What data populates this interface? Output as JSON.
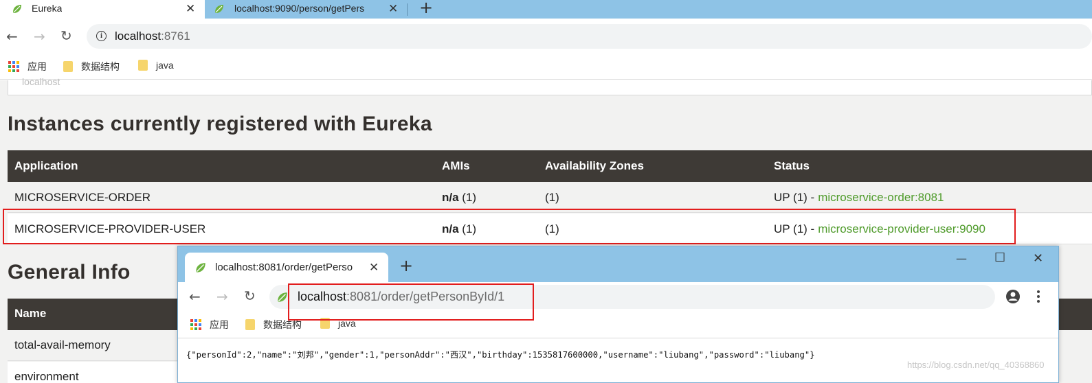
{
  "browser": {
    "tabs": [
      {
        "label": "Eureka",
        "icon": "spring-leaf-icon"
      },
      {
        "label": "localhost:9090/person/getPers"
      }
    ],
    "new_tab_symbol": "+",
    "close_symbol": "✕",
    "address": {
      "host": "localhost",
      "rest": ":8761"
    },
    "bookmarks": [
      "应用",
      "数据结构",
      "java"
    ]
  },
  "eureka": {
    "previous_value": "localhost",
    "instances_heading": "Instances currently registered with Eureka",
    "columns": [
      "Application",
      "AMIs",
      "Availability Zones",
      "Status"
    ],
    "rows": [
      {
        "application": "MICROSERVICE-ORDER",
        "ami_bold": "n/a",
        "ami_count": "(1)",
        "zones": "(1)",
        "status_prefix": "UP (1) -",
        "status_link": "microservice-order:8081"
      },
      {
        "application": "MICROSERVICE-PROVIDER-USER",
        "ami_bold": "n/a",
        "ami_count": "(1)",
        "zones": "(1)",
        "status_prefix": "UP (1) -",
        "status_link": "microservice-provider-user:9090"
      }
    ],
    "general_heading": "General Info",
    "general_columns": [
      "Name"
    ],
    "general_rows": [
      "total-avail-memory",
      "environment"
    ]
  },
  "popup": {
    "tab_label": "localhost:8081/order/getPerso",
    "address": {
      "host": "localhost",
      "rest": ":8081/order/getPersonById/1"
    },
    "bookmarks": [
      "应用",
      "数据结构",
      "java"
    ],
    "window_controls": {
      "minimize": "—",
      "maximize": "☐",
      "close": "✕"
    },
    "response_text": "{\"personId\":2,\"name\":\"刘邦\",\"gender\":1,\"personAddr\":\"西汉\",\"birthday\":1535817600000,\"username\":\"liubang\",\"password\":\"liubang\"}"
  },
  "watermark": "https://blog.csdn.net/qq_40368860",
  "colors": {
    "tab_strip": "#8ec3e6",
    "table_header": "#3e3a36",
    "status_link": "#4f9b2b",
    "highlight": "#e21d1d",
    "page_background": "#f2f2f1"
  }
}
